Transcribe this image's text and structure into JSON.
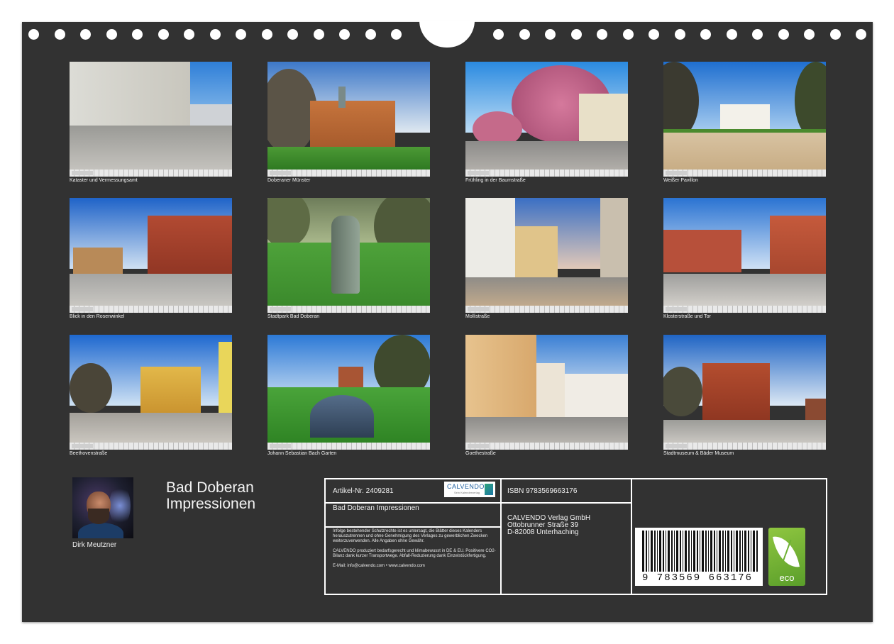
{
  "calendar": {
    "title_line1": "Bad Doberan",
    "title_line2": "Impressionen",
    "author": "Dirk Meutzner"
  },
  "photos": [
    {
      "caption": "Kataster und Vermessungsamt"
    },
    {
      "caption": "Doberaner Münster"
    },
    {
      "caption": "Frühling in der Baumstraße"
    },
    {
      "caption": "Weißer Pavillon"
    },
    {
      "caption": "Blick in den Rosenwinkel"
    },
    {
      "caption": "Stadtpark Bad Doberan"
    },
    {
      "caption": "Mollistraße"
    },
    {
      "caption": "Klosterstraße und Tor"
    },
    {
      "caption": "Beethovenstraße"
    },
    {
      "caption": "Johann Sebastian Bach Garten"
    },
    {
      "caption": "Goethestraße"
    },
    {
      "caption": "Stadtmuseum & Bäder Museum"
    }
  ],
  "info": {
    "article": "Artikel-Nr. 2409281",
    "logo_name": "CALVENDO",
    "logo_sub": "Sein Kalenderverlag",
    "product": "Bad Doberan Impressionen",
    "legal1": "Infolge bestehender Schutzrechte ist es untersagt, die Blätter dieses Kalenders herauszutrennen und ohne Genehmigung des Verlages zu gewerblichen Zwecken weiterzuverwenden. Alle Angaben ohne Gewähr.",
    "legal2": "CALVENDO produziert bedarfsgerecht und klimabewusst in DE & EU. Positivere CO2-Bilanz dank kurzer Transportwege. Abfall-Reduzierung dank Einzelstückfertigung.",
    "contact": "E-Mail: info@calvendo.com • www.calvendo.com",
    "isbn": "ISBN 9783569663176",
    "publisher_line1": "CALVENDO Verlag GmbH",
    "publisher_line2": "Ottobrunner Straße 39",
    "publisher_line3": "D-82008 Unterhaching",
    "barcode_number": "9 783569 663176",
    "eco_label": "eco"
  },
  "colors": {
    "background": "#323232",
    "text": "#f2f2f2",
    "eco_green": "#7ab536",
    "logo_blue": "#1d5fa0"
  }
}
